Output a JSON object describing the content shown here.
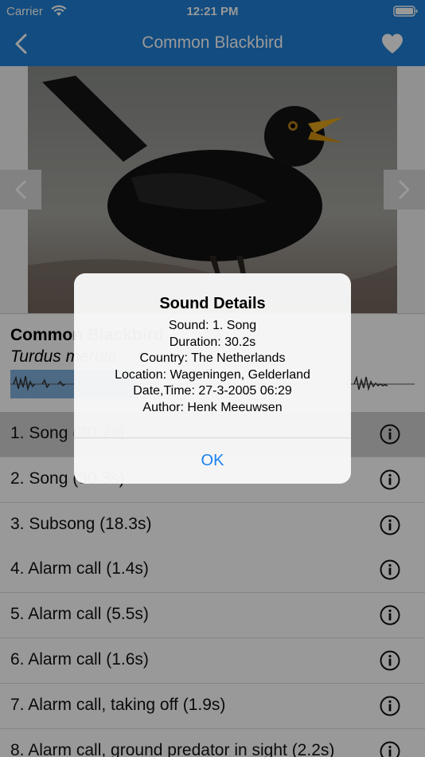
{
  "status_bar": {
    "carrier": "Carrier",
    "time": "12:21 PM",
    "icons": [
      "wifi-icon",
      "battery-icon"
    ]
  },
  "nav": {
    "title": "Common Blackbird",
    "back_icon": "chevron-left-icon",
    "favorite_icon": "heart-icon"
  },
  "species": {
    "common_name": "Common Blackbird",
    "latin_name": "Turdus merula"
  },
  "gallery": {
    "prev_icon": "chevron-left-icon",
    "next_icon": "chevron-right-icon"
  },
  "sounds": [
    {
      "label": "1. Song (30.2s)",
      "selected": true
    },
    {
      "label": "2. Song (30.3s)",
      "selected": false
    },
    {
      "label": "3. Subsong (18.3s)",
      "selected": false
    },
    {
      "label": "4. Alarm call (1.4s)",
      "selected": false
    },
    {
      "label": "5. Alarm call (5.5s)",
      "selected": false
    },
    {
      "label": "6. Alarm call (1.6s)",
      "selected": false
    },
    {
      "label": "7. Alarm call, taking off (1.9s)",
      "selected": false
    },
    {
      "label": "8. Alarm call, ground predator in sight (2.2s)",
      "selected": false
    }
  ],
  "dialog": {
    "title": "Sound Details",
    "lines": [
      "Sound: 1. Song",
      "Duration: 30.2s",
      "Country: The Netherlands",
      "Location: Wageningen, Gelderland",
      "Date,Time: 27-3-2005 06:29",
      "Author: Henk Meeuwsen"
    ],
    "ok_label": "OK"
  },
  "colors": {
    "nav_blue": "#1f7fd6",
    "accent_blue": "#1a82f0",
    "waveform_highlight": "#5b9bd5"
  }
}
